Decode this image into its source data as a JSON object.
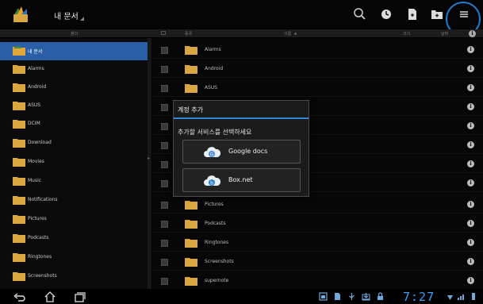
{
  "actionbar": {
    "title": "내 문서",
    "icons": [
      "search-icon",
      "history-clock-icon",
      "new-file-icon",
      "new-folder-icon",
      "menu-icon"
    ],
    "accent_color": "#1f7ed0"
  },
  "headers": {
    "folder": "폴더",
    "type": "종류",
    "name": "이름",
    "sort_indicator": "▲",
    "size": "크기",
    "date": "날짜"
  },
  "left_pane": {
    "items": [
      {
        "label": "내 문서",
        "selected": true
      },
      {
        "label": "Alarms"
      },
      {
        "label": "Android"
      },
      {
        "label": "ASUS"
      },
      {
        "label": "DCIM"
      },
      {
        "label": "Download"
      },
      {
        "label": "Movies"
      },
      {
        "label": "Music"
      },
      {
        "label": "Notifications"
      },
      {
        "label": "Pictures"
      },
      {
        "label": "Podcasts"
      },
      {
        "label": "Ringtones"
      },
      {
        "label": "Screenshots"
      }
    ]
  },
  "right_pane": {
    "rows": [
      {
        "name": "Alarms"
      },
      {
        "name": "Android"
      },
      {
        "name": "ASUS"
      },
      {
        "name": ""
      },
      {
        "name": ""
      },
      {
        "name": ""
      },
      {
        "name": ""
      },
      {
        "name": ""
      },
      {
        "name": "Pictures"
      },
      {
        "name": "Podcasts"
      },
      {
        "name": "Ringtones"
      },
      {
        "name": "Screenshots"
      },
      {
        "name": "supernote"
      }
    ],
    "info_glyph": "i"
  },
  "dialog": {
    "title": "계정 추가",
    "message": "추가할 서비스를 선택하세요",
    "options": [
      {
        "label": "Google docs",
        "icon": "google-docs-cloud-icon"
      },
      {
        "label": "Box.net",
        "icon": "box-net-cloud-icon"
      }
    ]
  },
  "system_bar": {
    "clock": "7:27",
    "nav_icons": [
      "back-icon",
      "home-icon",
      "recent-apps-icon"
    ],
    "status_icons": [
      "gallery-icon",
      "file-icon",
      "usb-icon",
      "download-icon",
      "lock-icon",
      "wifi-icon",
      "signal-icon",
      "battery-icon"
    ],
    "clock_color": "#3aa0ff"
  }
}
